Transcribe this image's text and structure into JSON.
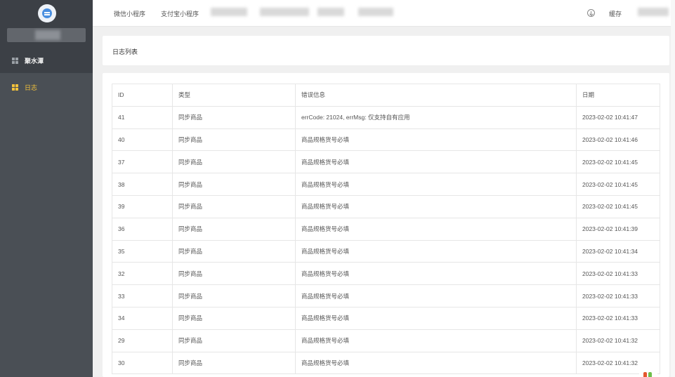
{
  "sidebar": {
    "items": [
      {
        "label": "聚水潭",
        "icon": "grid-icon"
      },
      {
        "label": "日志",
        "icon": "grid-icon"
      }
    ],
    "active_color": "#f5c33b",
    "logo_icon": "app-logo-icon"
  },
  "topbar": {
    "links": [
      "微信小程序",
      "支付宝小程序"
    ],
    "cache_label": "缓存",
    "download_icon": "download-circle-icon"
  },
  "page": {
    "title": "日志列表"
  },
  "table": {
    "headers": [
      "ID",
      "类型",
      "错误信息",
      "日期"
    ],
    "rows": [
      [
        "41",
        "同步商品",
        "errCode: 21024, errMsg: 仅支持自有应用",
        "2023-02-02 10:41:47"
      ],
      [
        "40",
        "同步商品",
        "商品规格货号必填",
        "2023-02-02 10:41:46"
      ],
      [
        "37",
        "同步商品",
        "商品规格货号必填",
        "2023-02-02 10:41:45"
      ],
      [
        "38",
        "同步商品",
        "商品规格货号必填",
        "2023-02-02 10:41:45"
      ],
      [
        "39",
        "同步商品",
        "商品规格货号必填",
        "2023-02-02 10:41:45"
      ],
      [
        "36",
        "同步商品",
        "商品规格货号必填",
        "2023-02-02 10:41:39"
      ],
      [
        "35",
        "同步商品",
        "商品规格货号必填",
        "2023-02-02 10:41:34"
      ],
      [
        "32",
        "同步商品",
        "商品规格货号必填",
        "2023-02-02 10:41:33"
      ],
      [
        "33",
        "同步商品",
        "商品规格货号必填",
        "2023-02-02 10:41:33"
      ],
      [
        "34",
        "同步商品",
        "商品规格货号必填",
        "2023-02-02 10:41:33"
      ],
      [
        "29",
        "同步商品",
        "商品规格货号必填",
        "2023-02-02 10:41:32"
      ],
      [
        "30",
        "同步商品",
        "商品规格货号必填",
        "2023-02-02 10:41:32"
      ]
    ]
  }
}
